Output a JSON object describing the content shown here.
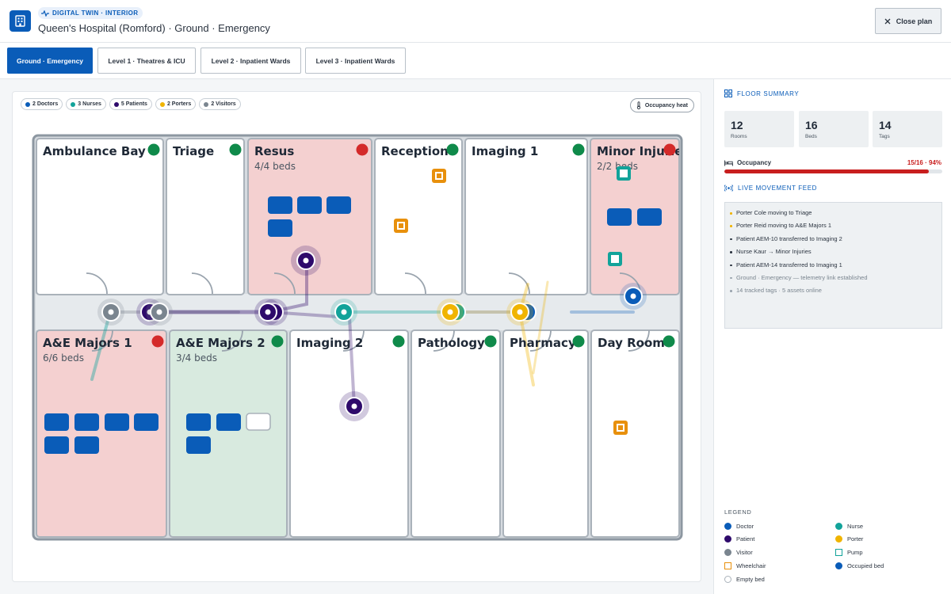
{
  "header": {
    "badge": "DIGITAL TWIN · INTERIOR",
    "title": "Queen's Hospital (Romford) · Ground · Emergency",
    "close_label": "Close plan"
  },
  "tabs": [
    {
      "label": "Ground · Emergency",
      "active": true
    },
    {
      "label": "Level 1 · Theatres & ICU",
      "active": false
    },
    {
      "label": "Level 2 · Inpatient Wards",
      "active": false
    },
    {
      "label": "Level 3 · Inpatient Wards",
      "active": false
    }
  ],
  "filters": [
    {
      "label": "2 Doctors",
      "color": "#0a5cb8"
    },
    {
      "label": "3 Nurses",
      "color": "#12a39a"
    },
    {
      "label": "5 Patients",
      "color": "#2e0a6b"
    },
    {
      "label": "2 Porters",
      "color": "#f0b400"
    },
    {
      "label": "2 Visitors",
      "color": "#7a858f"
    }
  ],
  "heat_label": "Occupancy heat",
  "rooms": {
    "ambulance_bay": {
      "name": "Ambulance Bay",
      "status": "green"
    },
    "triage": {
      "name": "Triage",
      "status": "green"
    },
    "resus": {
      "name": "Resus",
      "beds": "4/4 beds",
      "status": "red"
    },
    "reception": {
      "name": "Reception",
      "status": "green"
    },
    "imaging1": {
      "name": "Imaging 1",
      "status": "green"
    },
    "minor_injuries": {
      "name": "Minor Injuries",
      "beds": "2/2 beds",
      "status": "red"
    },
    "ae_majors1": {
      "name": "A&E Majors 1",
      "beds": "6/6 beds",
      "status": "red"
    },
    "ae_majors2": {
      "name": "A&E Majors 2",
      "beds": "3/4 beds",
      "status": "green"
    },
    "imaging2": {
      "name": "Imaging 2",
      "status": "green"
    },
    "pathology": {
      "name": "Pathology",
      "status": "green"
    },
    "pharmacy": {
      "name": "Pharmacy",
      "status": "green"
    },
    "day_room": {
      "name": "Day Room",
      "status": "green"
    }
  },
  "colors": {
    "doctor": "#0a5cb8",
    "nurse": "#12a39a",
    "patient": "#2e0a6b",
    "porter": "#f0b400",
    "visitor": "#7a858f",
    "wheelchair": "#e8900c",
    "status_green": "#0f8a4a",
    "status_red": "#d42a2a",
    "room_red": "#f4d0d0",
    "room_green": "#d8eadf"
  },
  "summary": {
    "title": "FLOOR SUMMARY",
    "stats": [
      {
        "value": "12",
        "label": "Rooms"
      },
      {
        "value": "16",
        "label": "Beds"
      },
      {
        "value": "14",
        "label": "Tags"
      }
    ],
    "occupancy_label": "Occupancy",
    "occupancy_value": "15/16 · 94%",
    "occupancy_fraction": 0.9375
  },
  "feed": {
    "title": "LIVE MOVEMENT FEED",
    "items": [
      {
        "text": "Porter Cole moving to Triage",
        "kind": "porter"
      },
      {
        "text": "Porter Reid moving to A&E Majors 1",
        "kind": "porter"
      },
      {
        "text": "Patient AEM-10 transferred to Imaging 2",
        "kind": "event"
      },
      {
        "text": "Nurse Kaur → Minor Injuries",
        "kind": "event"
      },
      {
        "text": "Patient AEM-14 transferred to Imaging 1",
        "kind": "event"
      },
      {
        "text": "Ground · Emergency — telemetry link established",
        "kind": "muted"
      },
      {
        "text": "14 tracked tags · 5 assets online",
        "kind": "muted"
      }
    ]
  },
  "legend": {
    "title": "LEGEND",
    "items": [
      {
        "label": "Doctor"
      },
      {
        "label": "Nurse"
      },
      {
        "label": "Patient"
      },
      {
        "label": "Porter"
      },
      {
        "label": "Visitor"
      },
      {
        "label": "Pump"
      },
      {
        "label": "Wheelchair"
      },
      {
        "label": "Occupied bed"
      },
      {
        "label": "Empty bed"
      }
    ]
  }
}
